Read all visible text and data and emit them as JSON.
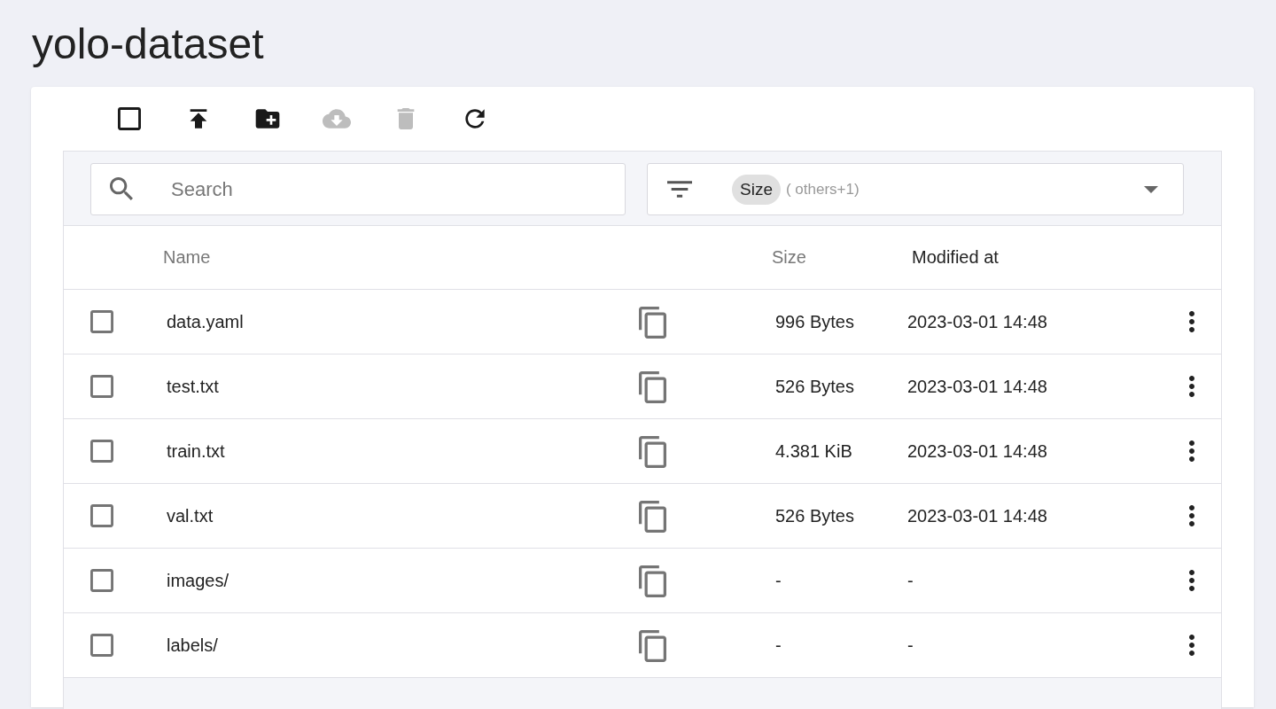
{
  "title": "yolo-dataset",
  "toolbar": [
    {
      "kind": "select-all",
      "checked": false,
      "disabled": false
    },
    {
      "kind": "upload",
      "disabled": false
    },
    {
      "kind": "new-folder",
      "disabled": false
    },
    {
      "kind": "download",
      "disabled": true
    },
    {
      "kind": "delete",
      "disabled": true
    },
    {
      "kind": "refresh",
      "disabled": false
    }
  ],
  "search": {
    "placeholder": "Search"
  },
  "filter": {
    "chip": "Size",
    "extra": "( others+1)"
  },
  "columns": [
    {
      "label": "Name",
      "selected": false
    },
    {
      "label": "Size",
      "selected": false
    },
    {
      "label": "Modified at",
      "selected": true
    }
  ],
  "rows": [
    {
      "name": "data.yaml",
      "size": "996 Bytes",
      "modified": "2023-03-01 14:48",
      "checked": false
    },
    {
      "name": "test.txt",
      "size": "526 Bytes",
      "modified": "2023-03-01 14:48",
      "checked": false
    },
    {
      "name": "train.txt",
      "size": "4.381 KiB",
      "modified": "2023-03-01 14:48",
      "checked": false
    },
    {
      "name": "val.txt",
      "size": "526 Bytes",
      "modified": "2023-03-01 14:48",
      "checked": false
    },
    {
      "name": "images/",
      "size": "-",
      "modified": "-",
      "checked": false
    },
    {
      "name": "labels/",
      "size": "-",
      "modified": "-",
      "checked": false
    }
  ]
}
